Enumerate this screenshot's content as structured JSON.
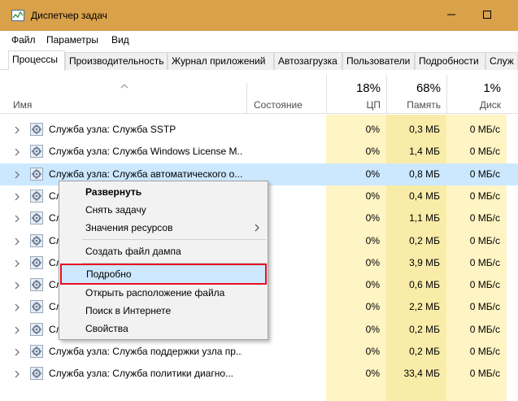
{
  "window": {
    "title": "Диспетчер задач",
    "colors": {
      "titlebar": "#d9a14a",
      "highlight_row": "#cce8ff",
      "heat_light": "#fff4c4",
      "heat_mid": "#f9eca8",
      "menu_selected_border": "#e81123"
    }
  },
  "menu": [
    "Файл",
    "Параметры",
    "Вид"
  ],
  "tabs": [
    "Процессы",
    "Производительность",
    "Журнал приложений",
    "Автозагрузка",
    "Пользователи",
    "Подробности",
    "Служ"
  ],
  "header": {
    "name": "Имя",
    "state": "Состояние",
    "cpu": {
      "pct": "18%",
      "label": "ЦП"
    },
    "memory": {
      "pct": "68%",
      "label": "Память"
    },
    "disk": {
      "pct": "1%",
      "label": "Диск"
    }
  },
  "rows": [
    {
      "name": "Служба узла: Служба SSTP",
      "cpu": "0%",
      "mem": "0,3 МБ",
      "disk": "0 МБ/с"
    },
    {
      "name": "Служба узла: Служба Windows License M...",
      "cpu": "0%",
      "mem": "1,4 МБ",
      "disk": "0 МБ/с"
    },
    {
      "name": "Служба узла: Служба автоматического о...",
      "cpu": "0%",
      "mem": "0,8 МБ",
      "disk": "0 МБ/с"
    },
    {
      "name": "Сл",
      "cpu": "0%",
      "mem": "0,4 МБ",
      "disk": "0 МБ/с"
    },
    {
      "name": "Сл",
      "cpu": "0%",
      "mem": "1,1 МБ",
      "disk": "0 МБ/с"
    },
    {
      "name": "Сл",
      "cpu": "0%",
      "mem": "0,2 МБ",
      "disk": "0 МБ/с"
    },
    {
      "name": "Сл",
      "cpu": "0%",
      "mem": "3,9 МБ",
      "disk": "0 МБ/с"
    },
    {
      "name": "Сл",
      "cpu": "0%",
      "mem": "0,6 МБ",
      "disk": "0 МБ/с"
    },
    {
      "name": "Сл",
      "cpu": "0%",
      "mem": "2,2 МБ",
      "disk": "0 МБ/с"
    },
    {
      "name": "Сл",
      "cpu": "0%",
      "mem": "0,2 МБ",
      "disk": "0 МБ/с"
    },
    {
      "name": "Служба узла: Служба поддержки узла пр...",
      "cpu": "0%",
      "mem": "0,2 МБ",
      "disk": "0 МБ/с"
    },
    {
      "name": "Служба узла: Служба политики диагно...",
      "cpu": "0%",
      "mem": "33,4 МБ",
      "disk": "0 МБ/с"
    }
  ],
  "context_menu": {
    "expand": "Развернуть",
    "end_task": "Снять задачу",
    "resource_values": "Значения ресурсов",
    "create_dump": "Создать файл дампа",
    "details": "Подробно",
    "open_location": "Открыть расположение файла",
    "search_online": "Поиск в Интернете",
    "properties": "Свойства"
  }
}
